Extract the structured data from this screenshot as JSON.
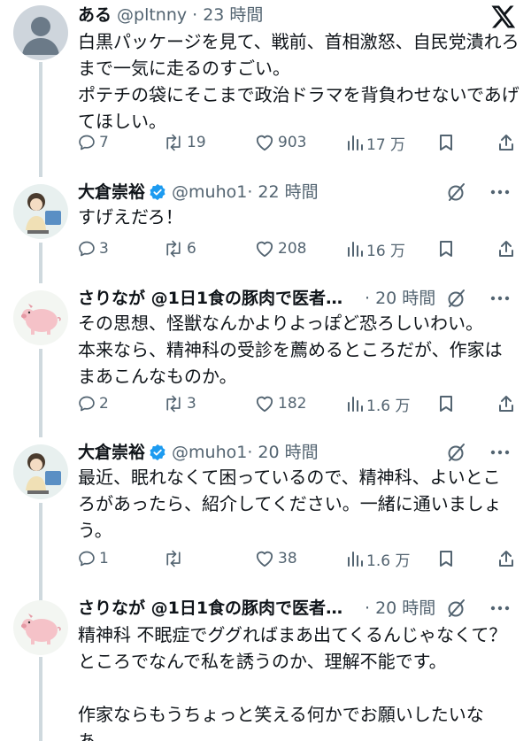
{
  "brand_icon": "x-logo-icon",
  "colors": {
    "text": "#0f1419",
    "muted": "#536471",
    "verified": "#1d9bf0",
    "line": "#cfd9de"
  },
  "tweets": [
    {
      "name": "ある",
      "handle": "@pltnny",
      "time": "· 23 時間",
      "verified": false,
      "body": "白黒パッケージを見て、戦前、首相激怒、自民党潰れろ\nまで一気に走るのすごい。\nポテチの袋にそこまで政治ドラマを背負わせないであげ\nてほしい。",
      "replies": "7",
      "retweets": "19",
      "likes": "903",
      "views": "17 万"
    },
    {
      "name": "大倉崇裕",
      "handle": "@muho1",
      "time": "· 22 時間",
      "verified": true,
      "body": "すげえだろ！",
      "replies": "3",
      "retweets": "6",
      "likes": "208",
      "views": "16 万"
    },
    {
      "name": "さりなが @1日1食の豚肉で医者い...",
      "handle": "",
      "time": "· 20 時間",
      "verified": false,
      "body": "その思想、怪獣なんかよりよっぽど恐ろしいわい。\n本来なら、精神科の受診を薦めるところだが、作家は\nまあこんなものか。",
      "replies": "2",
      "retweets": "3",
      "likes": "182",
      "views": "1.6 万"
    },
    {
      "name": "大倉崇裕",
      "handle": "@muho1",
      "time": "· 20 時間",
      "verified": true,
      "body": "最近、眠れなくて困っているので、精神科、よいとこ\nろがあったら、紹介してください。一緒に通いましょ\nう。",
      "replies": "1",
      "retweets": "",
      "likes": "38",
      "views": "1.6 万"
    },
    {
      "name": "さりなが @1日1食の豚肉で医者い...",
      "handle": "",
      "time": "· 20 時間",
      "verified": false,
      "body": "精神科 不眠症でググればまあ出てくるんじゃなくて？\nところでなんで私を誘うのか、理解不能です。\n\n作家ならもうちょっと笑える何かでお願いしたいな\nあ。"
    }
  ]
}
